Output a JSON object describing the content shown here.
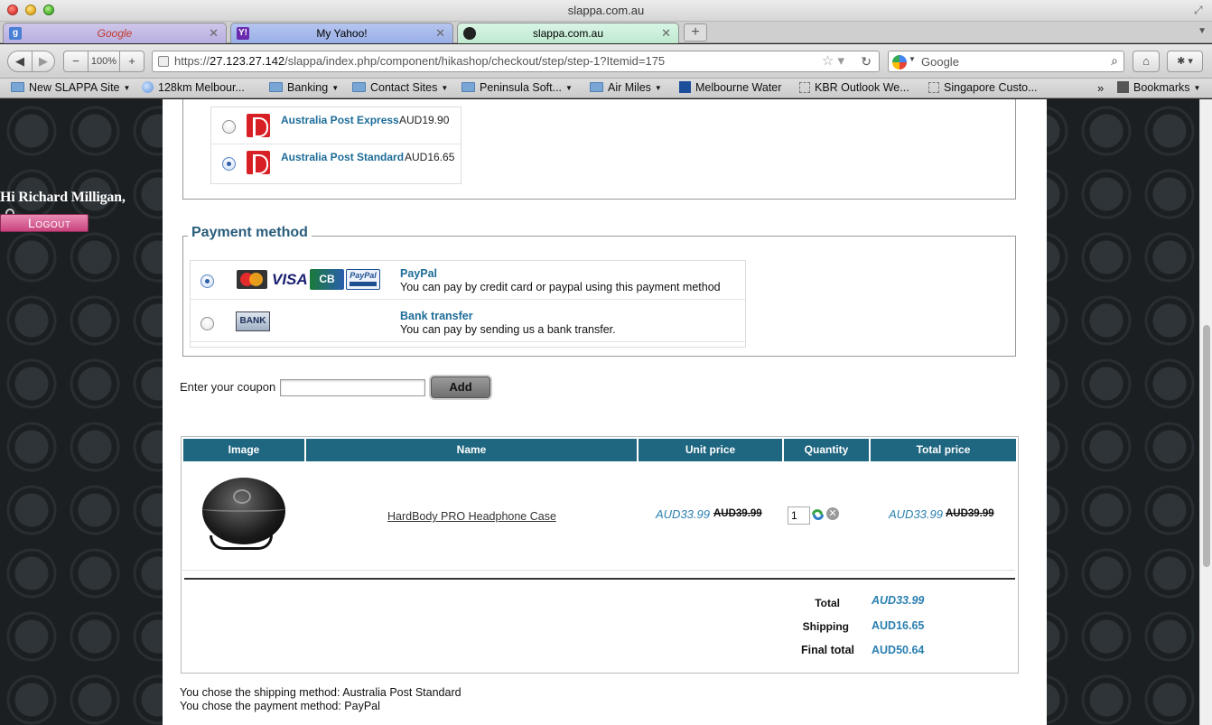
{
  "window": {
    "title": "slappa.com.au"
  },
  "tabs": [
    {
      "label": "Google",
      "favicon": "google-favicon"
    },
    {
      "label": "My Yahoo!",
      "favicon": "yahoo-favicon"
    },
    {
      "label": "slappa.com.au",
      "favicon": "slappa-favicon"
    }
  ],
  "toolbar": {
    "zoom": "100%",
    "url_prefix": "https://",
    "url_host": "27.123.27.142",
    "url_path": "/slappa/index.php/component/hikashop/checkout/step/step-1?Itemid=175",
    "search_placeholder": "Google"
  },
  "bookmarks": [
    {
      "label": "New SLAPPA Site",
      "icon": "folder-icon",
      "dropdown": true
    },
    {
      "label": "128km Melbour...",
      "icon": "globe-icon",
      "dropdown": false
    },
    {
      "label": "Banking",
      "icon": "folder-icon",
      "dropdown": true
    },
    {
      "label": "Contact Sites",
      "icon": "folder-icon",
      "dropdown": true
    },
    {
      "label": "Peninsula Soft...",
      "icon": "folder-icon",
      "dropdown": true
    },
    {
      "label": "Air Miles",
      "icon": "folder-icon",
      "dropdown": true
    },
    {
      "label": "Melbourne Water",
      "icon": "water-icon",
      "dropdown": false
    },
    {
      "label": "KBR Outlook We...",
      "icon": "page-icon",
      "dropdown": false
    },
    {
      "label": "Singapore Custo...",
      "icon": "page-icon",
      "dropdown": false
    }
  ],
  "bookmarks_menu": "Bookmarks",
  "user": {
    "greeting": "Hi Richard Milligan,",
    "logout_label": "Logout"
  },
  "shipping": {
    "options": [
      {
        "name": "Australia Post Express",
        "price": "AUD19.90",
        "selected": false
      },
      {
        "name": "Australia Post Standard",
        "price": "AUD16.65",
        "selected": true
      }
    ]
  },
  "payment": {
    "legend": "Payment method",
    "options": [
      {
        "name": "PayPal",
        "description": "You can pay by credit card or paypal using this payment method",
        "selected": true,
        "icons": [
          "mastercard-icon",
          "visa-icon",
          "cb-icon",
          "paypal-icon"
        ]
      },
      {
        "name": "Bank transfer",
        "description": "You can pay by sending us a bank transfer.",
        "selected": false,
        "icons": [
          "bank-icon"
        ]
      }
    ],
    "icon_text": {
      "visa": "VISA",
      "cb": "CB",
      "paypal": "PayPal",
      "bank": "BANK"
    }
  },
  "coupon": {
    "label": "Enter your coupon",
    "value": "",
    "add_label": "Add"
  },
  "cart": {
    "columns": [
      "Image",
      "Name",
      "Unit price",
      "Quantity",
      "Total price"
    ],
    "items": [
      {
        "name": "HardBody PRO Headphone Case",
        "unit_price": "AUD33.99",
        "unit_price_old": "AUD39.99",
        "quantity": "1",
        "total_price": "AUD33.99",
        "total_price_old": "AUD39.99"
      }
    ],
    "totals": [
      {
        "label": "Total",
        "value": "AUD33.99"
      },
      {
        "label": "Shipping",
        "value": "AUD16.65"
      },
      {
        "label": "Final total",
        "value": "AUD50.64"
      }
    ]
  },
  "summary": {
    "shipping_line": "You chose the shipping method: Australia Post Standard",
    "payment_line": "You chose the payment method: PayPal"
  }
}
